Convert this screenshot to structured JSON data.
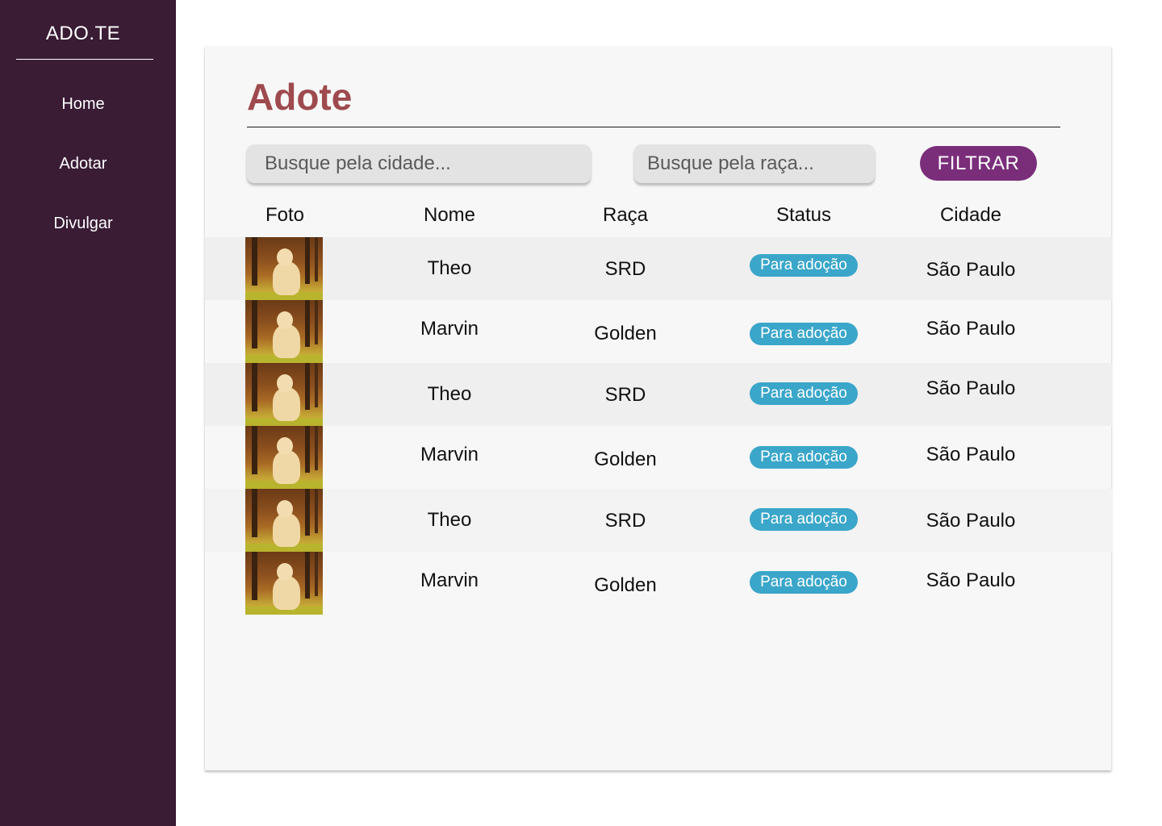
{
  "app": {
    "brand": "ADO.TE"
  },
  "sidebar": {
    "items": [
      {
        "label": "Home"
      },
      {
        "label": "Adotar"
      },
      {
        "label": "Divulgar"
      }
    ]
  },
  "main": {
    "title": "Adote",
    "search_city": {
      "placeholder": "Busque pela cidade..."
    },
    "search_breed": {
      "placeholder": "Busque pela raça..."
    },
    "filter_button": "FILTRAR",
    "columns": [
      "Foto",
      "Nome",
      "Raça",
      "Status",
      "Cidade"
    ],
    "rows": [
      {
        "nome": "Theo",
        "raca": "SRD",
        "status": "Para adoção",
        "cidade": "São Paulo"
      },
      {
        "nome": "Marvin",
        "raca": "Golden",
        "status": "Para adoção",
        "cidade": "São Paulo"
      },
      {
        "nome": "Theo",
        "raca": "SRD",
        "status": "Para adoção",
        "cidade": "São Paulo"
      },
      {
        "nome": "Marvin",
        "raca": "Golden",
        "status": "Para adoção",
        "cidade": "São Paulo"
      },
      {
        "nome": "Theo",
        "raca": "SRD",
        "status": "Para adoção",
        "cidade": "São Paulo"
      },
      {
        "nome": "Marvin",
        "raca": "Golden",
        "status": "Para adoção",
        "cidade": "São Paulo"
      }
    ]
  },
  "colors": {
    "sidebar_bg": "#3a1c35",
    "title": "#9e4a4e",
    "filter_button": "#7a2e7a",
    "status_badge": "#3aa6c9"
  }
}
